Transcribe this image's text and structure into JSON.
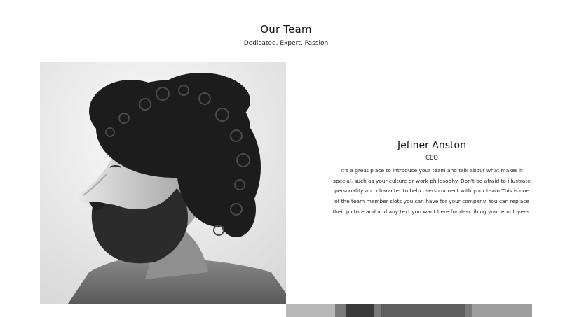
{
  "section": {
    "title": "Our Team",
    "subtitle": "Dedicated, Expert. Passion"
  },
  "member": {
    "name": "Jefiner Anston",
    "role": "CEO",
    "bio": "It's a great place to introduce your team and talk about what makes it special, such as your culture or work philosophy. Don't be afraid to illustrate personality and character to help users connect with your team.This is one of the team member slots you can have for your company. You can replace their picture and add any text you want here for describing your employees.",
    "photo_style": "black-and-white profile portrait"
  }
}
